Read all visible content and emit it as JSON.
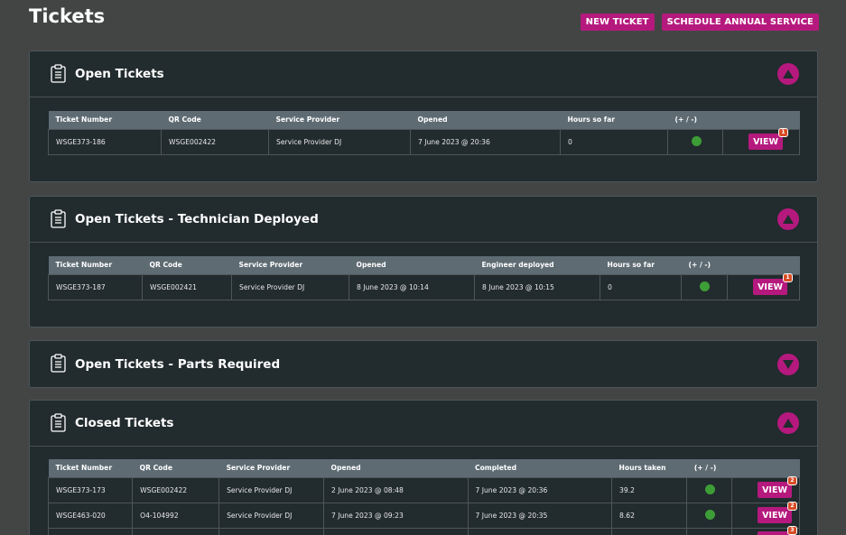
{
  "page": {
    "title": "Tickets"
  },
  "actions": {
    "new_ticket": "NEW TICKET",
    "schedule": "SCHEDULE ANNUAL SERVICE"
  },
  "colors": {
    "accent": "#b5197d",
    "status_ok": "#3d9d36",
    "badge": "#d94c25",
    "panel_bg": "#222b2e",
    "header_bg": "#5e6b73"
  },
  "open": {
    "title": "Open Tickets",
    "expanded": true,
    "headers": [
      "Ticket Number",
      "QR Code",
      "Service Provider",
      "Opened",
      "Hours so far",
      "(+ / -)",
      ""
    ],
    "rows": [
      {
        "ticket": "WSGE373-186",
        "qr": "WSGE002422",
        "provider": "Service Provider DJ",
        "opened": "7 June 2023 @ 20:36",
        "hours": "0",
        "status": "green",
        "view": "VIEW",
        "badge": "1"
      }
    ]
  },
  "deployed": {
    "title": "Open Tickets - Technician Deployed",
    "expanded": true,
    "headers": [
      "Ticket Number",
      "QR Code",
      "Service Provider",
      "Opened",
      "Engineer deployed",
      "Hours so far",
      "(+ / -)",
      ""
    ],
    "rows": [
      {
        "ticket": "WSGE373-187",
        "qr": "WSGE002421",
        "provider": "Service Provider DJ",
        "opened": "8 June 2023 @ 10:14",
        "deployed": "8 June 2023 @ 10:15",
        "hours": "0",
        "status": "green",
        "view": "VIEW",
        "badge": "1"
      }
    ]
  },
  "parts": {
    "title": "Open Tickets - Parts Required",
    "expanded": false
  },
  "closed": {
    "title": "Closed Tickets",
    "expanded": true,
    "headers": [
      "Ticket Number",
      "QR Code",
      "Service Provider",
      "Opened",
      "Completed",
      "Hours taken",
      "(+ / -)",
      ""
    ],
    "rows": [
      {
        "ticket": "WSGE373-173",
        "qr": "WSGE002422",
        "provider": "Service Provider DJ",
        "opened": "2 June 2023 @ 08:48",
        "completed": "7 June 2023 @ 20:36",
        "hours": "39.2",
        "status": "green",
        "view": "VIEW",
        "badge": "2"
      },
      {
        "ticket": "WSGE463-020",
        "qr": "O4-104992",
        "provider": "Service Provider DJ",
        "opened": "7 June 2023 @ 09:23",
        "completed": "7 June 2023 @ 20:35",
        "hours": "8.62",
        "status": "green",
        "view": "VIEW",
        "badge": "2"
      },
      {
        "ticket": "",
        "qr": "",
        "provider": "",
        "opened": "",
        "completed": "",
        "hours": "",
        "status": "",
        "view": "",
        "badge": "3"
      }
    ]
  }
}
